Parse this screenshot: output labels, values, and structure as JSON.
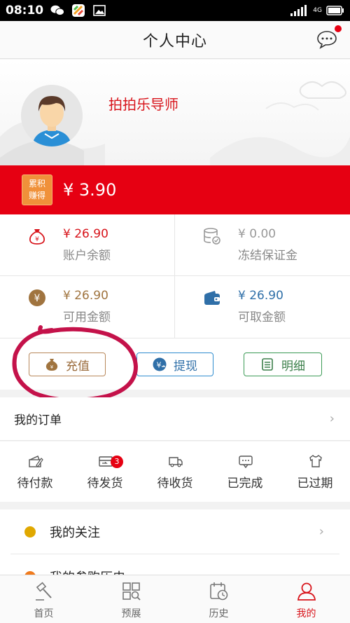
{
  "status_bar": {
    "time": "08:10",
    "network": "4G"
  },
  "header": {
    "title": "个人中心"
  },
  "profile": {
    "username": "拍拍乐导师"
  },
  "earned": {
    "badge_line1": "累积",
    "badge_line2": "赚得",
    "amount": "¥ 3.90"
  },
  "balances": [
    {
      "amount": "¥ 26.90",
      "label": "账户余额",
      "color": "#d8141b"
    },
    {
      "amount": "¥ 0.00",
      "label": "冻结保证金",
      "color": "#999999"
    },
    {
      "amount": "¥ 26.90",
      "label": "可用金额",
      "color": "#a0743f"
    },
    {
      "amount": "¥ 26.90",
      "label": "可取金额",
      "color": "#2f6fa8"
    }
  ],
  "actions": {
    "recharge": "充值",
    "withdraw": "提现",
    "detail": "明细"
  },
  "orders": {
    "title": "我的订单",
    "items": [
      {
        "label": "待付款"
      },
      {
        "label": "待发货",
        "badge": "3"
      },
      {
        "label": "待收货"
      },
      {
        "label": "已完成"
      },
      {
        "label": "已过期"
      }
    ]
  },
  "list": [
    {
      "label": "我的关注",
      "dot_color": "#e0a800"
    },
    {
      "label": "我的参购历史",
      "dot_color": "#f07b1d"
    }
  ],
  "tabs": [
    {
      "label": "首页",
      "icon": "gavel-icon"
    },
    {
      "label": "预展",
      "icon": "grid-search-icon"
    },
    {
      "label": "历史",
      "icon": "calendar-clock-icon"
    },
    {
      "label": "我的",
      "icon": "user-icon",
      "active": true
    }
  ],
  "colors": {
    "brand_red": "#e60012",
    "earned_badge": "#f0913a"
  }
}
